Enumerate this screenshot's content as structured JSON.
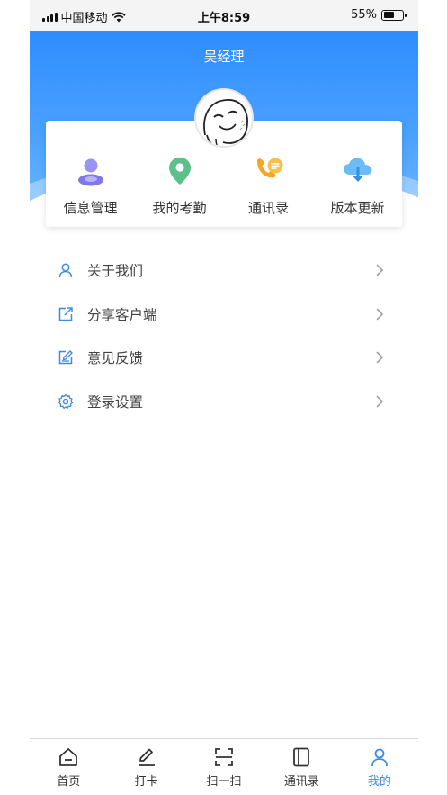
{
  "status_bar": {
    "carrier": "中国移动",
    "time": "上午8:59",
    "battery": "55%",
    "battery_level": 0.55
  },
  "header": {
    "manager_name": "吴经理",
    "accent_color": "#2e8cff"
  },
  "quick_actions": [
    {
      "label": "信息管理",
      "icon": "user-profile-icon",
      "color": "#8a84f0"
    },
    {
      "label": "我的考勤",
      "icon": "location-pin-icon",
      "color": "#5cc08a"
    },
    {
      "label": "通讯录",
      "icon": "phone-chat-icon",
      "color": "#f5a623"
    },
    {
      "label": "版本更新",
      "icon": "cloud-download-icon",
      "color": "#4fa9f0"
    }
  ],
  "menu": [
    {
      "label": "关于我们",
      "icon": "person-icon"
    },
    {
      "label": "分享客户端",
      "icon": "share-icon"
    },
    {
      "label": "意见反馈",
      "icon": "edit-icon"
    },
    {
      "label": "登录设置",
      "icon": "gear-icon"
    }
  ],
  "tabs": [
    {
      "label": "首页",
      "icon": "home-icon",
      "active": false
    },
    {
      "label": "打卡",
      "icon": "pen-icon",
      "active": false
    },
    {
      "label": "扫一扫",
      "icon": "scan-icon",
      "active": false
    },
    {
      "label": "通讯录",
      "icon": "contacts-icon",
      "active": false
    },
    {
      "label": "我的",
      "icon": "profile-icon",
      "active": true
    }
  ]
}
